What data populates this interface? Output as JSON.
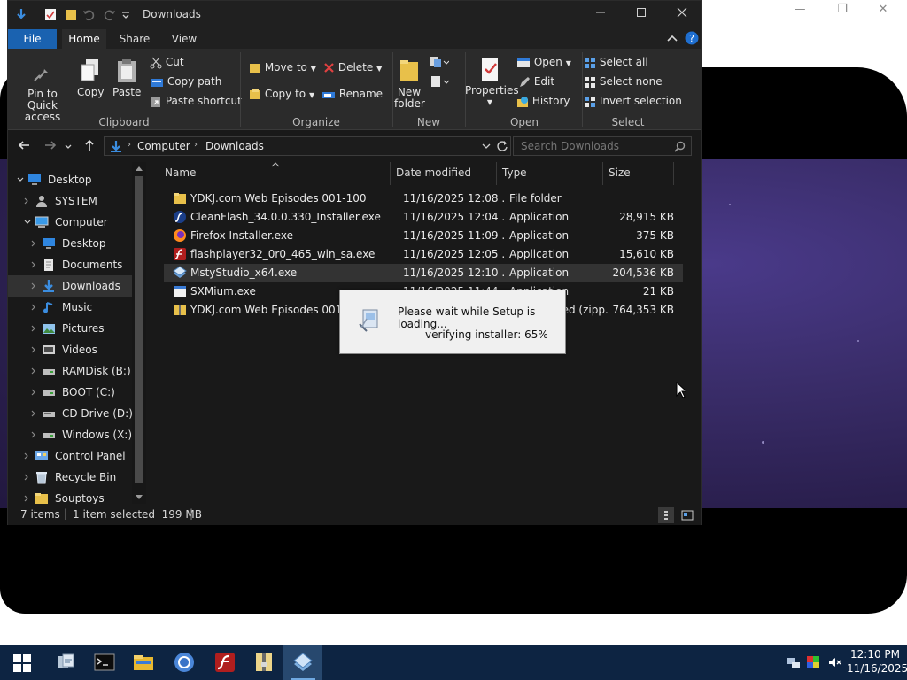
{
  "background_window": {
    "controls": [
      "—",
      "❐",
      "✕"
    ]
  },
  "explorer": {
    "title": "Downloads",
    "tabs": [
      {
        "label": "File"
      },
      {
        "label": "Home"
      },
      {
        "label": "Share"
      },
      {
        "label": "View"
      }
    ],
    "ribbon": {
      "clipboard": {
        "group_label": "Clipboard",
        "pin_label": "Pin to Quick access",
        "copy_label": "Copy",
        "paste_label": "Paste",
        "cut_label": "Cut",
        "copy_path_label": "Copy path",
        "paste_shortcut_label": "Paste shortcut"
      },
      "organize": {
        "group_label": "Organize",
        "move_to_label": "Move to",
        "copy_to_label": "Copy to",
        "delete_label": "Delete",
        "rename_label": "Rename"
      },
      "new": {
        "group_label": "New",
        "new_folder_label": "New folder"
      },
      "open": {
        "group_label": "Open",
        "properties_label": "Properties",
        "open_label": "Open",
        "edit_label": "Edit",
        "history_label": "History"
      },
      "select": {
        "group_label": "Select",
        "select_all_label": "Select all",
        "select_none_label": "Select none",
        "invert_label": "Invert selection"
      }
    },
    "address": {
      "segments": [
        "Computer",
        "Downloads"
      ],
      "search_placeholder": "Search Downloads"
    },
    "nav": [
      {
        "label": "Desktop",
        "level": 0,
        "icon": "desktop-icon",
        "expanded": true
      },
      {
        "label": "SYSTEM",
        "level": 1,
        "icon": "user-icon",
        "expanded": false
      },
      {
        "label": "Computer",
        "level": 1,
        "icon": "computer-icon",
        "expanded": true
      },
      {
        "label": "Desktop",
        "level": 2,
        "icon": "desktop-icon",
        "expanded": false
      },
      {
        "label": "Documents",
        "level": 2,
        "icon": "documents-icon",
        "expanded": false
      },
      {
        "label": "Downloads",
        "level": 2,
        "icon": "downloads-icon",
        "expanded": false,
        "selected": true
      },
      {
        "label": "Music",
        "level": 2,
        "icon": "music-icon",
        "expanded": false
      },
      {
        "label": "Pictures",
        "level": 2,
        "icon": "pictures-icon",
        "expanded": false
      },
      {
        "label": "Videos",
        "level": 2,
        "icon": "videos-icon",
        "expanded": false
      },
      {
        "label": "RAMDisk (B:)",
        "level": 2,
        "icon": "drive-icon",
        "expanded": false
      },
      {
        "label": "BOOT (C:)",
        "level": 2,
        "icon": "drive-icon",
        "expanded": false
      },
      {
        "label": "CD Drive (D:)",
        "level": 2,
        "icon": "cd-drive-icon",
        "expanded": false
      },
      {
        "label": "Windows (X:)",
        "level": 2,
        "icon": "drive-icon",
        "expanded": false
      },
      {
        "label": "Control Panel",
        "level": 1,
        "icon": "control-panel-icon",
        "expanded": false
      },
      {
        "label": "Recycle Bin",
        "level": 1,
        "icon": "recycle-bin-icon",
        "expanded": false
      },
      {
        "label": "Souptoys",
        "level": 1,
        "icon": "folder-icon",
        "expanded": false
      }
    ],
    "columns": {
      "name": "Name",
      "date": "Date modified",
      "type": "Type",
      "size": "Size"
    },
    "files": [
      {
        "name": "YDKJ.com Web Episodes 001-100",
        "date": "11/16/2025 12:08 ...",
        "type": "File folder",
        "size": "",
        "icon": "folder-icon"
      },
      {
        "name": "CleanFlash_34.0.0.330_Installer.exe",
        "date": "11/16/2025 12:04 ...",
        "type": "Application",
        "size": "28,915 KB",
        "icon": "cleanflash-icon"
      },
      {
        "name": "Firefox Installer.exe",
        "date": "11/16/2025 11:09 ...",
        "type": "Application",
        "size": "375 KB",
        "icon": "firefox-icon"
      },
      {
        "name": "flashplayer32_0r0_465_win_sa.exe",
        "date": "11/16/2025 12:05 ...",
        "type": "Application",
        "size": "15,610 KB",
        "icon": "flash-icon"
      },
      {
        "name": "MstyStudio_x64.exe",
        "date": "11/16/2025 12:10 ...",
        "type": "Application",
        "size": "204,536 KB",
        "icon": "msty-icon",
        "selected": true
      },
      {
        "name": "SXMium.exe",
        "date": "11/16/2025 11:44 ...",
        "type": "Application",
        "size": "21 KB",
        "icon": "application-icon"
      },
      {
        "name": "YDKJ.com Web Episodes 001-100.zip",
        "date": "11/16/2025 12:00 ...",
        "type": "Compressed (zipp...",
        "size": "764,353 KB",
        "icon": "zip-icon"
      }
    ],
    "status": {
      "item_count": "7 items",
      "selection": "1 item selected  199 MB"
    }
  },
  "dialog": {
    "message": "Please wait while Setup is loading...",
    "progress": "verifying installer: 65%"
  },
  "taskbar": {
    "apps": [
      "start-icon",
      "file-transfer-icon",
      "terminal-icon",
      "file-explorer-icon",
      "chrome-icon",
      "flash-icon",
      "archive-icon",
      "msty-icon"
    ],
    "clock_time": "12:10 PM",
    "clock_date": "11/16/2025"
  },
  "colors": {
    "explorer_bg": "#191919",
    "ribbon_bg": "#2b2b2b",
    "accent": "#1a62b0",
    "taskbar_bg": "#0d2442",
    "dialog_bg": "#f0f0f0"
  }
}
